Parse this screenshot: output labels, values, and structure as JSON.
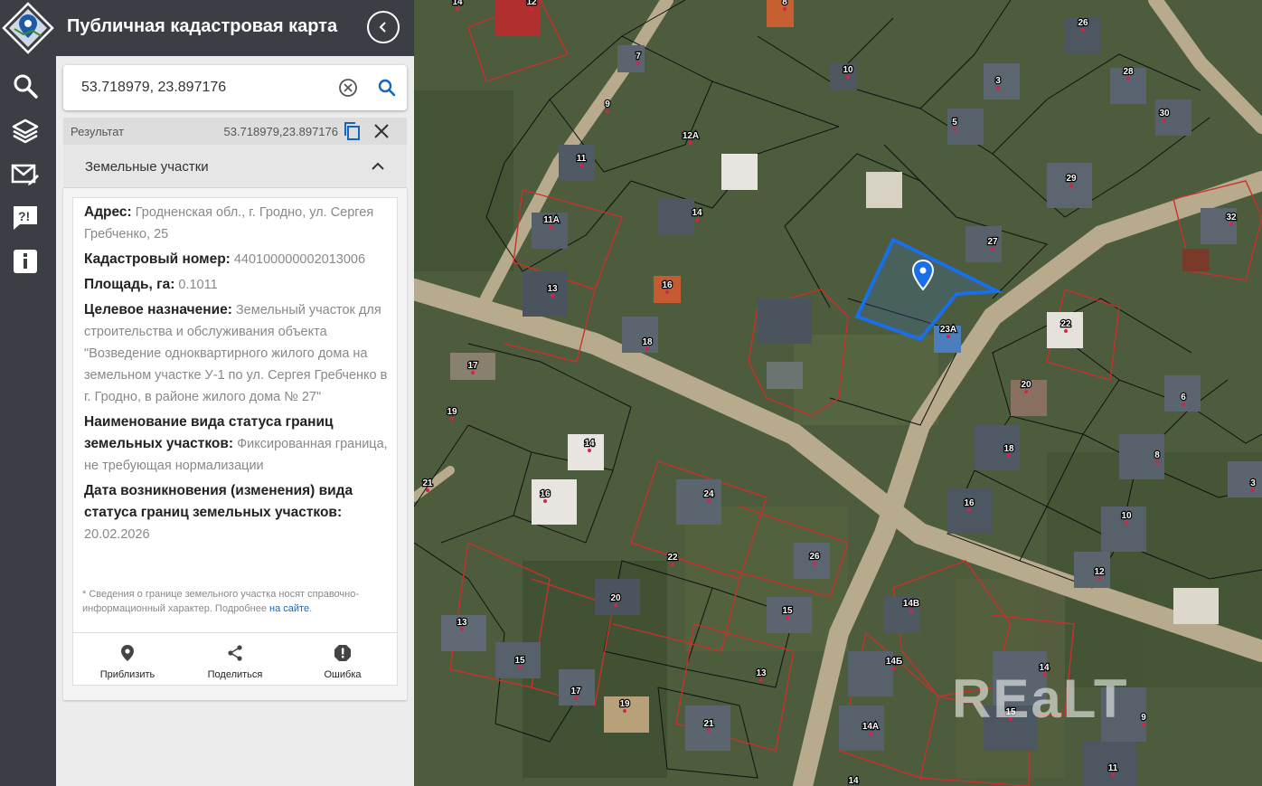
{
  "header": {
    "title": "Публичная кадастровая карта"
  },
  "rail": {
    "icons": [
      "app-logo-icon",
      "search-icon",
      "layers-icon",
      "mail-edit-icon",
      "feedback-icon",
      "info-icon"
    ]
  },
  "search": {
    "value": "53.718979, 23.897176"
  },
  "result": {
    "label": "Результат",
    "coords": "53.718979,23.897176"
  },
  "section": {
    "title": "Земельные участки"
  },
  "parcel": {
    "address_label": "Адрес:",
    "address_value": "Гродненская обл., г. Гродно, ул. Сергея Гребченко, 25",
    "cadastral_label": "Кадастровый номер:",
    "cadastral_value": "440100000002013006",
    "area_label": "Площадь, га:",
    "area_value": "0.1011",
    "purpose_label": "Целевое назначение:",
    "purpose_value": "Земельный участок для строительства и обслуживания объекта \"Возведение одноквартирного жилого дома на земельном участке У-1 по ул. Сергея Гребченко в г. Гродно, в районе жилого дома № 27\"",
    "status_label": "Наименование вида статуса границ земельных участков:",
    "status_value": "Фиксированная граница, не требующая нормализации",
    "date_label": "Дата возникновения (изменения) вида статуса границ земельных участков:",
    "date_value": "20.02.2026"
  },
  "note": {
    "text": "* Сведения о границе земельного участка носят справочно-информационный характер. Подробнее",
    "link": "на сайте",
    "tail": "."
  },
  "actions": {
    "zoom": "Приблизить",
    "share": "Поделиться",
    "error": "Ошибка"
  },
  "map": {
    "watermark": "REaLT",
    "labels": [
      "14",
      "12",
      "8",
      "26",
      "7",
      "10",
      "3",
      "28",
      "9",
      "12А",
      "5",
      "30",
      "11",
      "29",
      "14",
      "27",
      "32",
      "11А",
      "16",
      "13",
      "18",
      "23А",
      "22",
      "17",
      "20",
      "6",
      "19",
      "14",
      "18",
      "21",
      "8",
      "16",
      "16",
      "24",
      "10",
      "3",
      "22",
      "26",
      "12",
      "20",
      "15",
      "14В",
      "13",
      "15",
      "14Б",
      "14",
      "17",
      "19",
      "13",
      "21",
      "14А",
      "15",
      "9",
      "14",
      "11"
    ],
    "colors": {
      "selected_parcel": "#1a6fe8",
      "red_boundary": "#c8312b",
      "black_boundary": "#111111"
    }
  }
}
